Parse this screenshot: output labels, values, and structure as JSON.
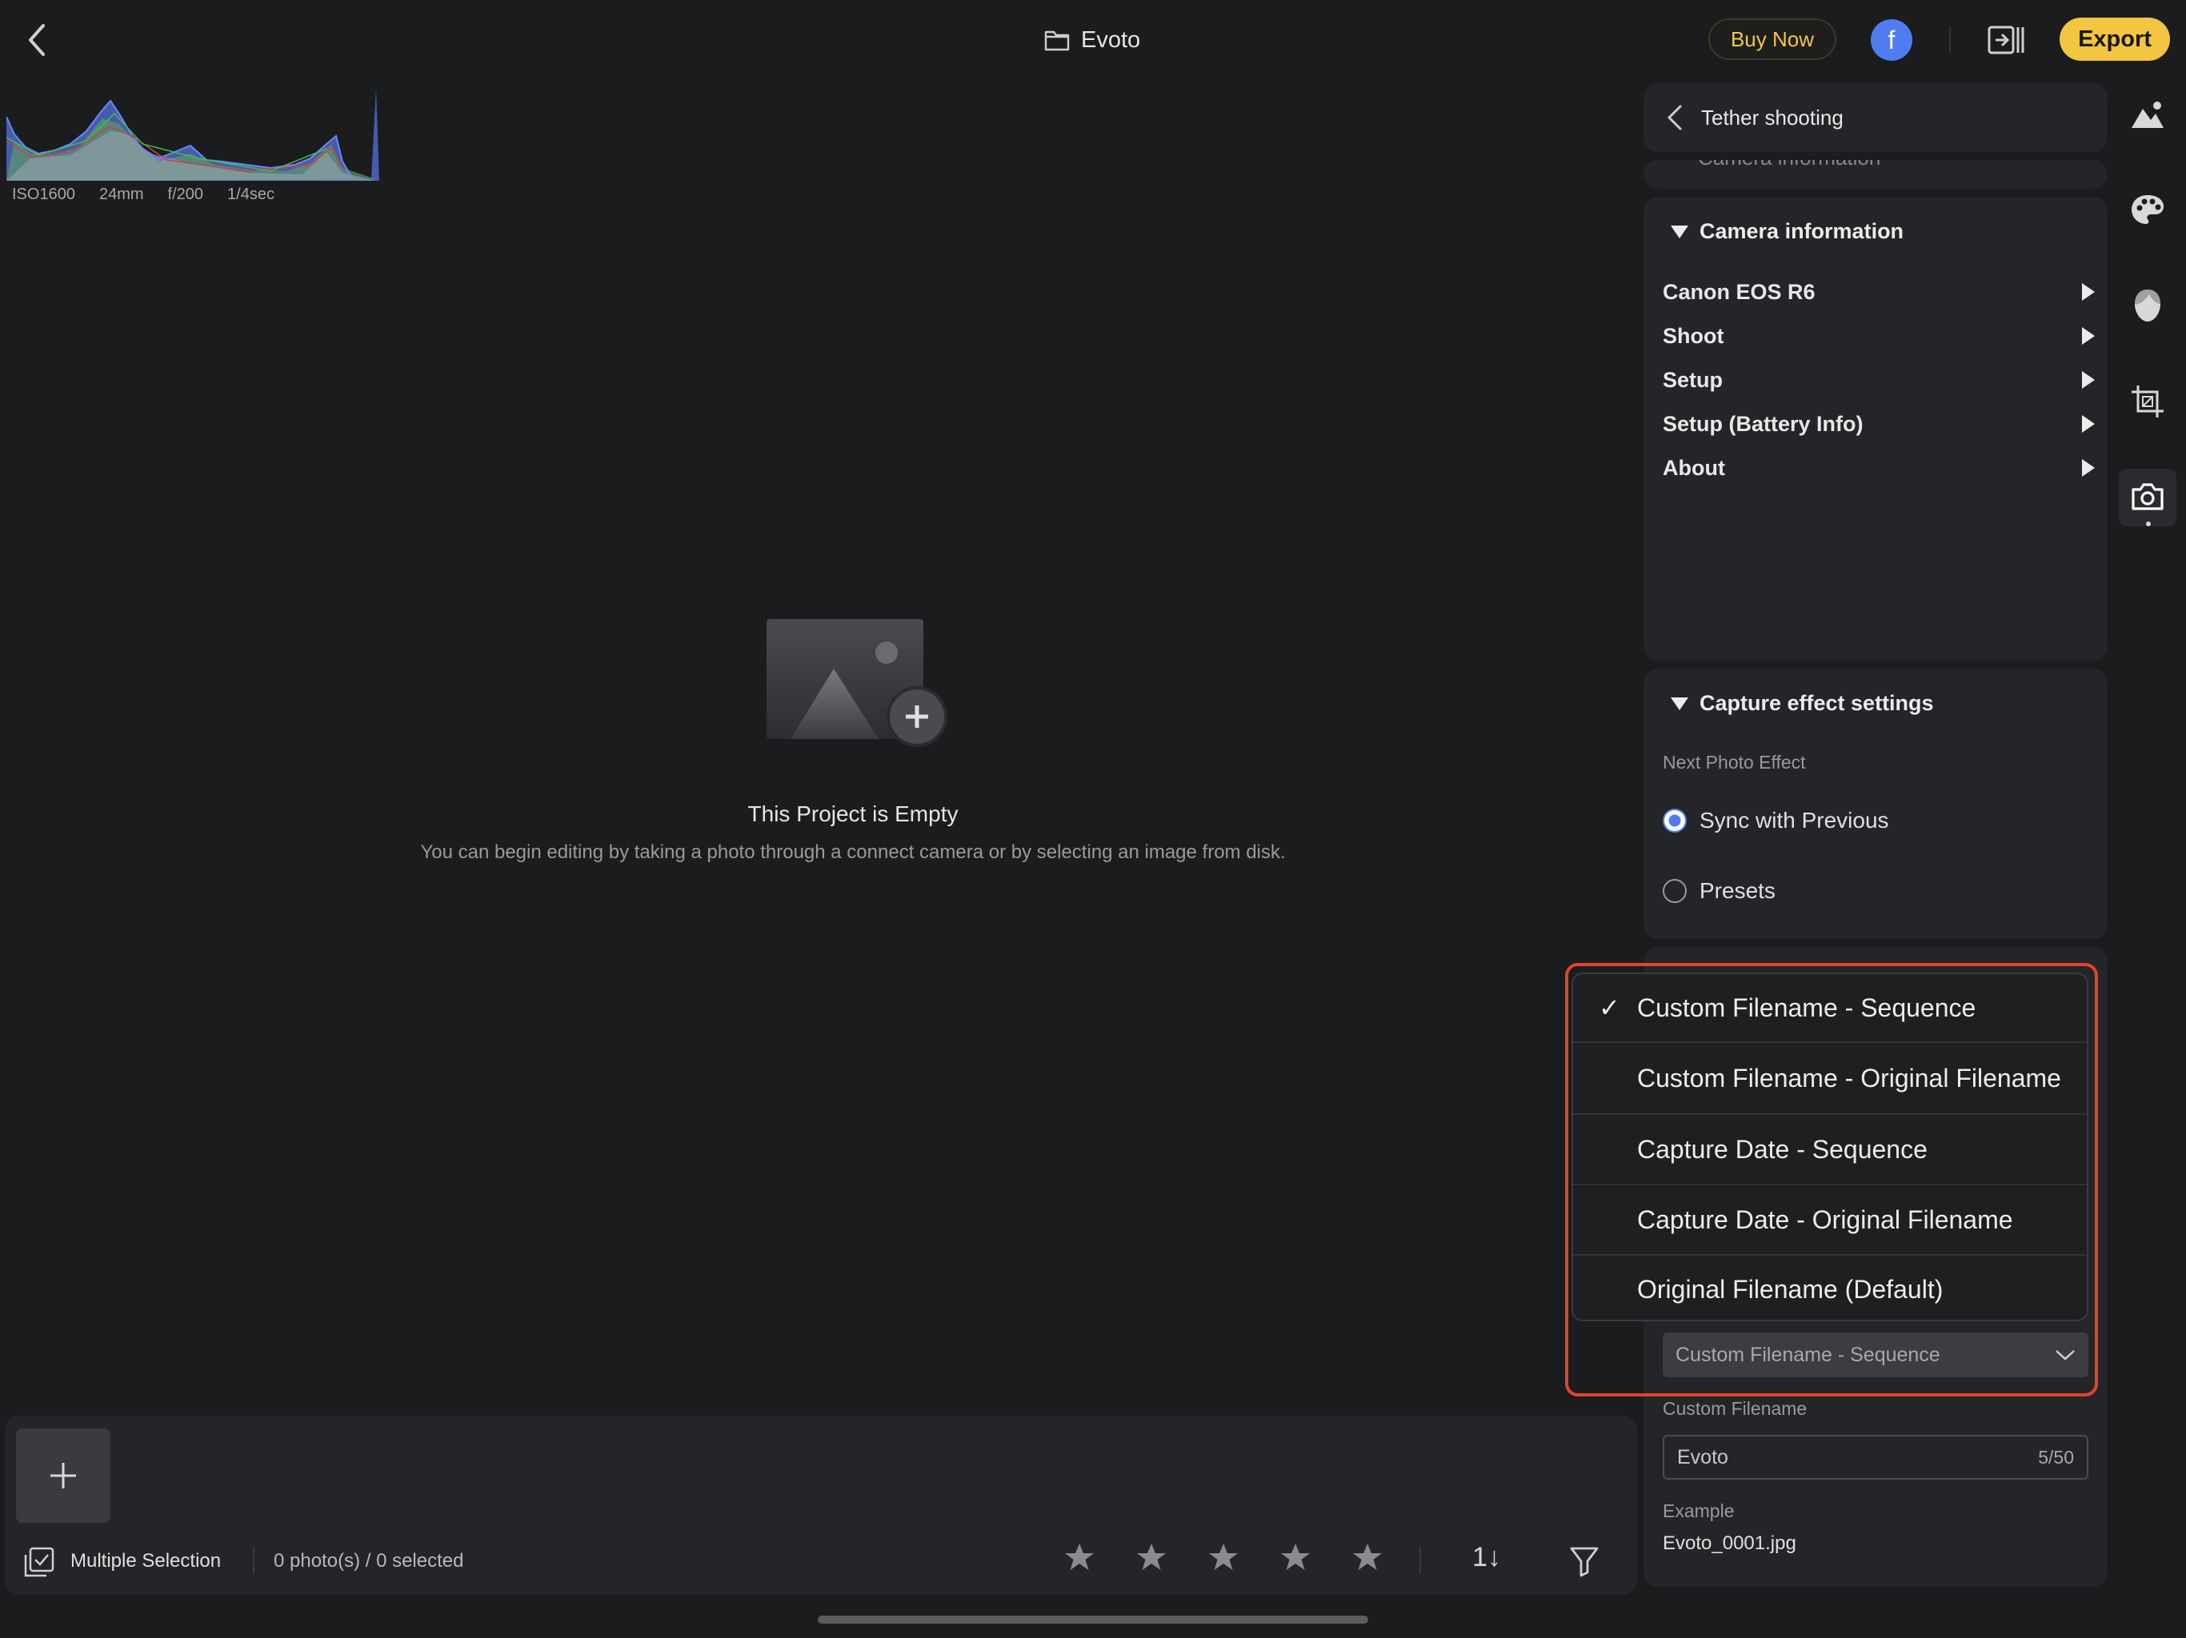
{
  "header": {
    "project_title": "Evoto",
    "buy_label": "Buy Now",
    "avatar_letter": "f",
    "export_label": "Export"
  },
  "histogram": {
    "exif": [
      "ISO1600",
      "24mm",
      "f/200",
      "1/4sec"
    ]
  },
  "empty_state": {
    "title": "This Project is Empty",
    "subtitle": "You can begin editing by taking a photo through a connect camera or by selecting an image from disk."
  },
  "bottom_bar": {
    "multi_label": "Multiple Selection",
    "count_label": "0 photo(s) / 0 selected",
    "sort_label": "1↓",
    "stars": 5
  },
  "panel": {
    "tether_title": "Tether shooting",
    "peek_label": "Camera information",
    "camera_section": {
      "title": "Camera information",
      "items": [
        "Canon EOS R6",
        "Shoot",
        "Setup",
        "Setup (Battery Info)",
        "About"
      ]
    },
    "effect_section": {
      "title": "Capture effect settings",
      "sub_label": "Next Photo Effect",
      "options": [
        {
          "label": "Sync with Previous",
          "selected": true
        },
        {
          "label": "Presets",
          "selected": false
        }
      ]
    },
    "naming": {
      "selected": "Custom Filename - Sequence",
      "custom_label": "Custom Filename",
      "custom_value": "Evoto",
      "custom_count": "5/50",
      "example_label": "Example",
      "example_value": "Evoto_0001.jpg"
    }
  },
  "dropdown": {
    "check": "✓",
    "options": [
      "Custom Filename - Sequence",
      "Custom Filename - Original Filename",
      "Capture Date - Sequence",
      "Capture Date - Original Filename",
      "Original Filename (Default)"
    ]
  },
  "colors": {
    "accent_yellow": "#f4c542",
    "accent_blue": "#4f7cf0",
    "highlight_red": "#e0452c"
  }
}
